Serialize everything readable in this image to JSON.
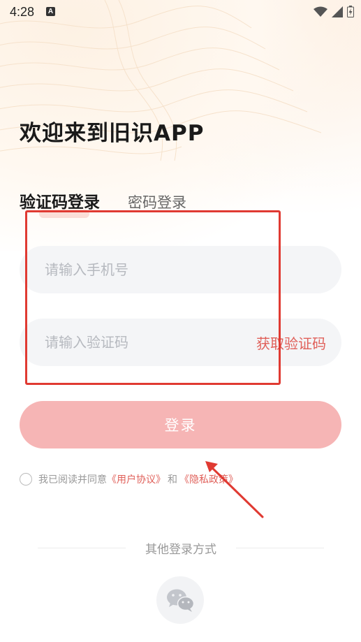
{
  "status_bar": {
    "time": "4:28",
    "notification_letter": "A"
  },
  "welcome_title": "欢迎来到旧识APP",
  "tabs": [
    {
      "label": "验证码登录",
      "active": true
    },
    {
      "label": "密码登录",
      "active": false
    }
  ],
  "phone_input": {
    "placeholder": "请输入手机号",
    "value": ""
  },
  "code_input": {
    "placeholder": "请输入验证码",
    "value": ""
  },
  "get_code_label": "获取验证码",
  "login_button_label": "登录",
  "agreement": {
    "prefix": "我已阅读并同意",
    "user_agreement": "《用户协议》",
    "and": "和",
    "privacy_policy": "《隐私政策》"
  },
  "other_login_label": "其他登录方式",
  "colors": {
    "accent": "#e0605a",
    "login_button": "#f6b5b5",
    "annotation": "#e03a32"
  },
  "icons": {
    "social_login": "wechat-icon"
  }
}
